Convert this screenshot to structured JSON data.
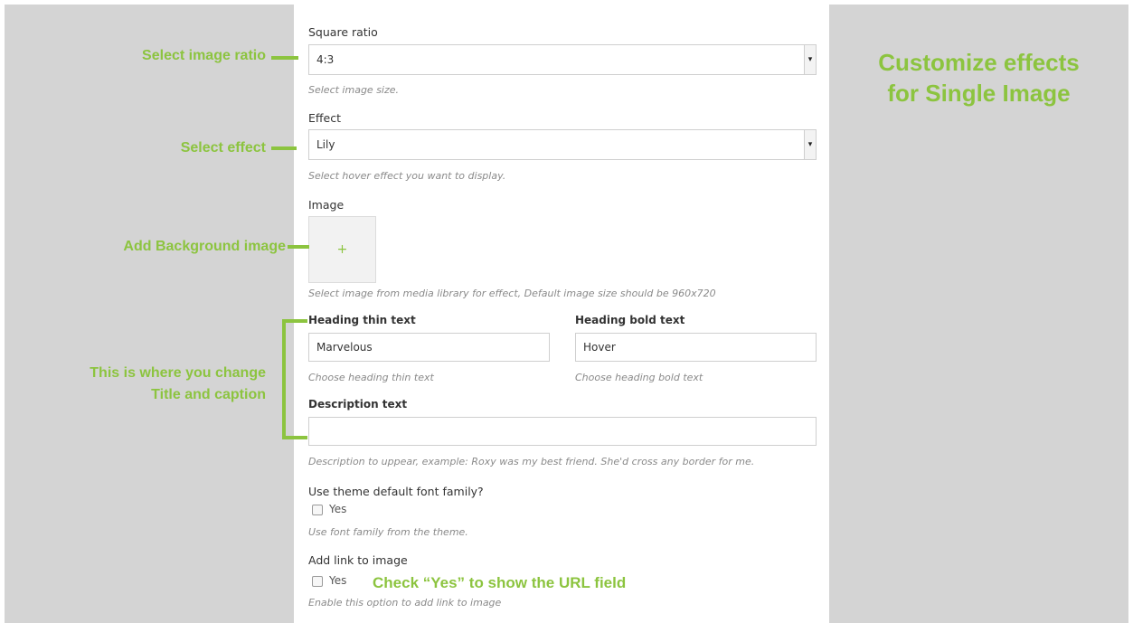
{
  "form": {
    "ratio": {
      "label": "Square ratio",
      "value": "4:3",
      "help": "Select image size."
    },
    "effect": {
      "label": "Effect",
      "value": "Lily",
      "help": "Select hover effect you want to display."
    },
    "image": {
      "label": "Image",
      "add_symbol": "+",
      "help": "Select image from media library for effect, Default image size should be 960x720"
    },
    "heading_thin": {
      "label": "Heading thin text",
      "value": "Marvelous",
      "help": "Choose heading thin text"
    },
    "heading_bold": {
      "label": "Heading bold text",
      "value": "Hover",
      "help": "Choose heading bold text"
    },
    "description": {
      "label": "Description text",
      "value": "",
      "help": "Description to uppear, example: Roxy was my best friend. She'd cross any border for me."
    },
    "theme_font": {
      "label": "Use theme default font family?",
      "checkbox_label": "Yes",
      "checked": false,
      "help": "Use font family from the theme."
    },
    "link": {
      "label": "Add link to image",
      "checkbox_label": "Yes",
      "checked": false,
      "help": "Enable this option to add link to image"
    }
  },
  "annotations": {
    "ratio": "Select image ratio",
    "effect": "Select effect",
    "image": "Add Background image",
    "title_line1": "This is where you change",
    "title_line2": "Title and caption",
    "link": "Check “Yes” to show the URL field",
    "headline_line1": "Customize effects",
    "headline_line2": "for Single Image"
  },
  "colors": {
    "accent": "#8cc43f",
    "side_background": "#d4d4d4",
    "panel_background": "#ffffff"
  },
  "icons": {
    "select_arrow": "caret-down-icon",
    "add_image": "plus-icon"
  }
}
